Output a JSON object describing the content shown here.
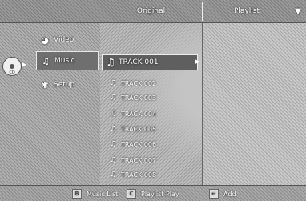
{
  "header": {
    "original_label": "Original",
    "playlist_label": "Playlist"
  },
  "menu": {
    "items": [
      {
        "label": "Video",
        "icon": "video-icon"
      },
      {
        "label": "Music",
        "icon": "music-icon"
      },
      {
        "label": "Setup",
        "icon": "setup-icon"
      }
    ]
  },
  "disc": {
    "label": "CD"
  },
  "tracks": [
    "TRACK 001",
    "TRACK 002",
    "TRACK 003",
    "TRACK 004",
    "TRACK 005",
    "TRACK 006",
    "TRACK 007",
    "TRACK 008"
  ],
  "footer": {
    "music_list": "Music List",
    "playlist_play": "Playlist Play",
    "add": "Add"
  }
}
